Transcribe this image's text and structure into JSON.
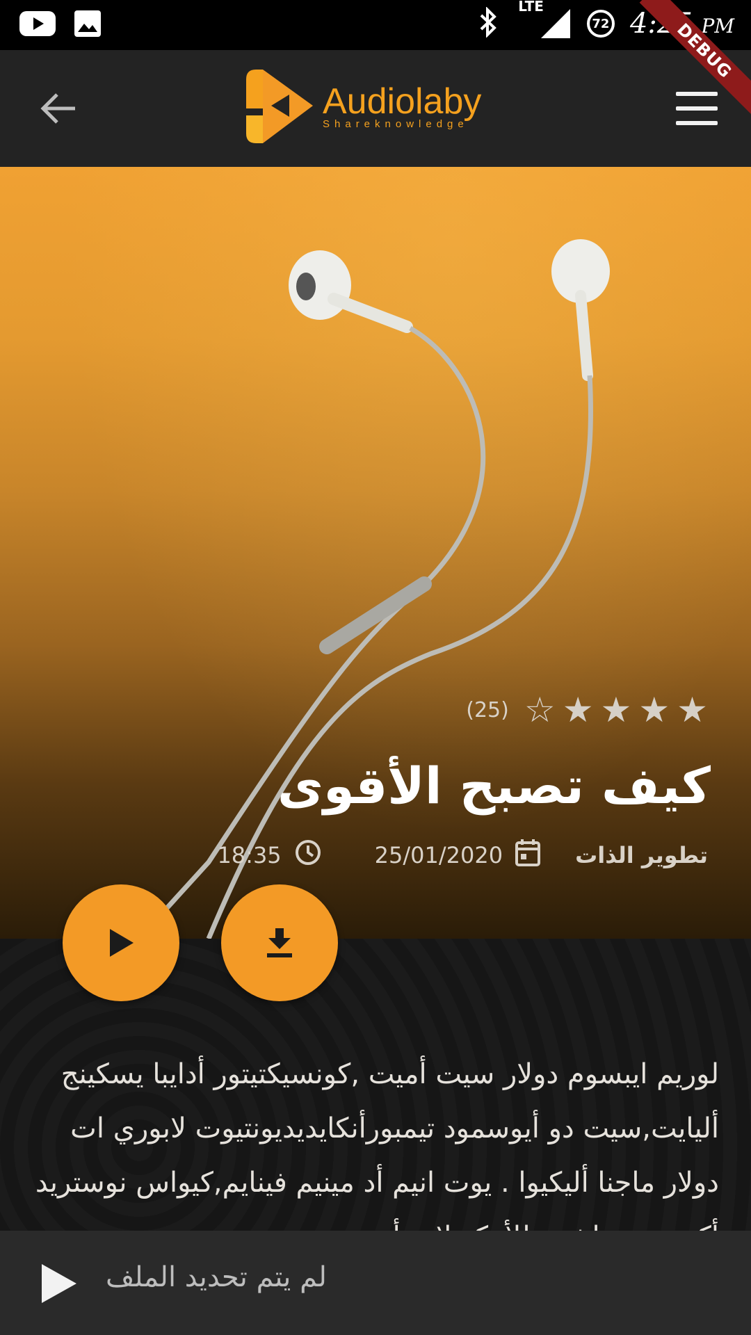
{
  "status_bar": {
    "time": "4:25",
    "period": "PM",
    "network": "LTE",
    "battery": "72",
    "debug_label": "DEBUG"
  },
  "app_bar": {
    "brand_name": "Audiolaby",
    "brand_tagline": "Shareknowledge"
  },
  "hero": {
    "rating_count": "(25)",
    "stars_filled": 4,
    "stars_total": 5,
    "title": "كيف تصبح الأقوى",
    "category": "تطوير الذات",
    "date": "25/01/2020",
    "duration": "18:35"
  },
  "description": "لوريم ايبسوم دولار سيت أميت ,كونسيكتيتور أدايبا يسكينج أليايت,سيت دو أيوسمود تيمبورأنكايديديونتيوت لابوري ات دولار ماجنا أليكيوا . يوت انيم أد مينيم فينايم,كيواس نوستريد أكسير سيتاشن يللأمكو لابورأس نيسي يت",
  "player": {
    "status_text": "لم يتم تحديد الملف"
  },
  "colors": {
    "accent": "#f39a26",
    "app_bar": "#232323",
    "player_bar": "#2a2a2a"
  }
}
